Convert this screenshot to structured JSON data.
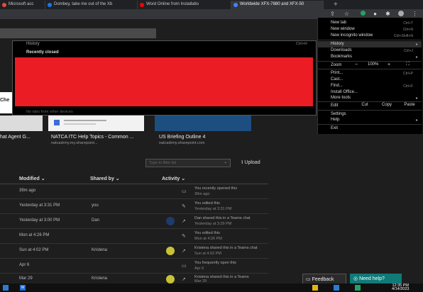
{
  "browser": {
    "tabs": [
      {
        "label": "Microsoft acc",
        "color": "#e74c3c"
      },
      {
        "label": "Dombey, take me out of the Xb",
        "color": "#1877f2"
      },
      {
        "label": "Word Online from Installatio",
        "color": "#ff0000"
      },
      {
        "label": "Worldwide XFX-7880 and XFX-50",
        "color": "#4285f4"
      }
    ],
    "new_tab_glyph": "+"
  },
  "history_menu": {
    "title": "History",
    "shortcut": "Ctrl+H",
    "recently_closed": "Recently closed",
    "other_devices": "No tabs from other devices"
  },
  "chrome_menu": {
    "new_tab": "New tab",
    "new_tab_sc": "Ctrl+T",
    "new_window": "New window",
    "new_window_sc": "Ctrl+N",
    "new_incognito": "New incognito window",
    "new_incognito_sc": "Ctrl+Shift+N",
    "history": "History",
    "downloads": "Downloads",
    "downloads_sc": "Ctrl+J",
    "bookmarks": "Bookmarks",
    "zoom": "Zoom",
    "zoom_minus": "−",
    "zoom_value": "100%",
    "zoom_plus": "+",
    "print": "Print...",
    "print_sc": "Ctrl+P",
    "cast": "Cast...",
    "find": "Find...",
    "find_sc": "Ctrl+F",
    "install_office": "Install Office...",
    "more_tools": "More tools",
    "edit": "Edit",
    "cut": "Cut",
    "copy": "Copy",
    "paste": "Paste",
    "settings": "Settings",
    "help": "Help",
    "exit": "Exit"
  },
  "page": {
    "left_fragment": "Che",
    "cards": [
      {
        "title": "hat Agent G...",
        "sub": ""
      },
      {
        "title": "NATCA ITC Help Topics - Common ...",
        "sub": "natcadrmy.my.sharepoint..."
      },
      {
        "title": "US Briefing Outline 4",
        "sub": "natcadrmy.sharepoint.com"
      }
    ],
    "filter_placeholder": "Type to filter list",
    "upload_label": "Upload",
    "columns": {
      "modified": "Modified",
      "shared_by": "Shared by",
      "activity": "Activity"
    },
    "rows": [
      {
        "modified": "39m ago",
        "shared_by": "",
        "act1": "You recently opened this",
        "act2": "39m ago",
        "avatar": ""
      },
      {
        "modified": "Yesterday at 3:31 PM",
        "shared_by": "you",
        "act1": "You edited this",
        "act2": "Yesterday at 3:31 PM",
        "avatar": ""
      },
      {
        "modified": "Yesterday at 3:00 PM",
        "shared_by": "Dan",
        "act1": "Dan shared this in a Teams chat",
        "act2": "Yesterday at 3:29 PM",
        "avatar": "#1f3a6b"
      },
      {
        "modified": "Mon at 4:26 PM",
        "shared_by": "",
        "act1": "You edited this",
        "act2": "Mon at 4:26 PM",
        "avatar": ""
      },
      {
        "modified": "Sun at 4:02 PM",
        "shared_by": "Kristena",
        "act1": "Kristena shared this in a Teams chat",
        "act2": "Sun at 4:02 PM",
        "avatar": "#c9c236"
      },
      {
        "modified": "Apr 6",
        "shared_by": "",
        "act1": "You frequently open this",
        "act2": "Apr 6",
        "avatar": ""
      },
      {
        "modified": "Mar 29",
        "shared_by": "Kristena",
        "act1": "Kristena shared this in a Teams",
        "act2": "Mar 29",
        "avatar": "#c9c236"
      }
    ],
    "feedback_label": "Feedback",
    "need_help_label": "Need help?"
  },
  "taskbar": {
    "time": "12:35 PM",
    "date": "4/14/2023"
  },
  "colors": {
    "redaction": "#ec1c24",
    "accent": "#0f7a78"
  }
}
